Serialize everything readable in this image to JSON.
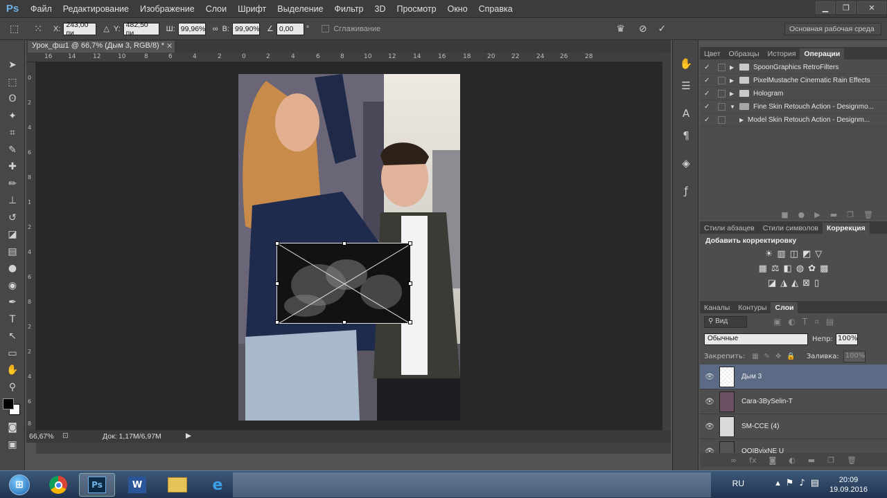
{
  "app": {
    "logo": "Ps"
  },
  "menu": [
    "Файл",
    "Редактирование",
    "Изображение",
    "Слои",
    "Шрифт",
    "Выделение",
    "Фильтр",
    "3D",
    "Просмотр",
    "Окно",
    "Справка"
  ],
  "options": {
    "x_label": "X:",
    "x_value": "243,00 пи",
    "y_label": "Y:",
    "y_value": "482,50 пи",
    "w_label": "Ш:",
    "w_value": "99,96%",
    "h_label": "В:",
    "h_value": "99,90%",
    "angle_value": "0,00",
    "angle_unit": "°",
    "smoothing_label": "Сглаживание",
    "workspace": "Основная рабочая среда"
  },
  "document": {
    "tab_title": "Урок_фш1 @ 66,7% (Дым 3, RGB/8) *",
    "ruler_h": [
      "16",
      "14",
      "12",
      "10",
      "8",
      "6",
      "4",
      "2",
      "0",
      "2",
      "4",
      "6",
      "8",
      "10",
      "12",
      "14",
      "16",
      "18",
      "20",
      "22",
      "24",
      "26",
      "28"
    ],
    "ruler_v": [
      "0",
      "2",
      "4",
      "6",
      "8",
      "1",
      "2",
      "4",
      "6",
      "8",
      "2",
      "2",
      "4",
      "6",
      "8"
    ],
    "zoom": "66,67%",
    "doc_info": "Док: 1,17M/6,97M"
  },
  "actions_panel": {
    "tabs": [
      "Цвет",
      "Образцы",
      "История",
      "Операции"
    ],
    "active_tab": "Операции",
    "items": [
      {
        "name": "SpoonGraphics RetroFilters",
        "expanded": false
      },
      {
        "name": "PixelMustache Cinematic Rain Effects",
        "expanded": false
      },
      {
        "name": "Hologram",
        "expanded": false
      },
      {
        "name": "Fine Skin Retouch Action - Designmo...",
        "expanded": true
      },
      {
        "name": "Model Skin Retouch Action - Designm...",
        "expanded": false
      }
    ]
  },
  "adjust_panel": {
    "tabs": [
      "Стили абзацев",
      "Стили символов",
      "Коррекция"
    ],
    "active_tab": "Коррекция",
    "title": "Добавить корректировку"
  },
  "layers_panel": {
    "tabs": [
      "Каналы",
      "Контуры",
      "Слои"
    ],
    "active_tab": "Слои",
    "filter_label": "Вид",
    "blend_mode": "Обычные",
    "opacity_label": "Непр:",
    "opacity_value": "100%",
    "lock_label": "Закрепить:",
    "fill_label": "Заливка:",
    "fill_value": "100%",
    "layers": [
      {
        "name": "Дым 3",
        "selected": true
      },
      {
        "name": "Cara-3BySelin-T",
        "selected": false
      },
      {
        "name": "SM-CCE (4)",
        "selected": false
      },
      {
        "name": "OOIBvixNE U",
        "selected": false
      }
    ]
  },
  "taskbar": {
    "lang": "RU",
    "time": "20:09",
    "date": "19.09.2016"
  }
}
